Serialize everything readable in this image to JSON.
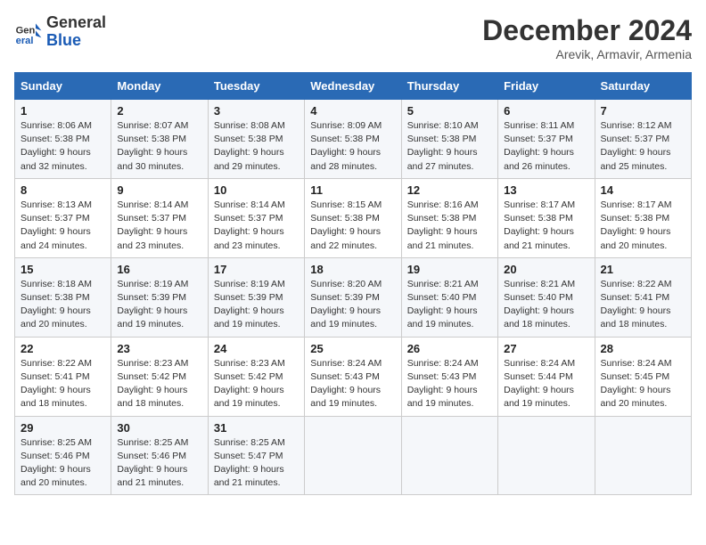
{
  "header": {
    "logo_line1": "General",
    "logo_line2": "Blue",
    "month": "December 2024",
    "location": "Arevik, Armavir, Armenia"
  },
  "days_of_week": [
    "Sunday",
    "Monday",
    "Tuesday",
    "Wednesday",
    "Thursday",
    "Friday",
    "Saturday"
  ],
  "weeks": [
    [
      {
        "day": "1",
        "info": "Sunrise: 8:06 AM\nSunset: 5:38 PM\nDaylight: 9 hours\nand 32 minutes."
      },
      {
        "day": "2",
        "info": "Sunrise: 8:07 AM\nSunset: 5:38 PM\nDaylight: 9 hours\nand 30 minutes."
      },
      {
        "day": "3",
        "info": "Sunrise: 8:08 AM\nSunset: 5:38 PM\nDaylight: 9 hours\nand 29 minutes."
      },
      {
        "day": "4",
        "info": "Sunrise: 8:09 AM\nSunset: 5:38 PM\nDaylight: 9 hours\nand 28 minutes."
      },
      {
        "day": "5",
        "info": "Sunrise: 8:10 AM\nSunset: 5:38 PM\nDaylight: 9 hours\nand 27 minutes."
      },
      {
        "day": "6",
        "info": "Sunrise: 8:11 AM\nSunset: 5:37 PM\nDaylight: 9 hours\nand 26 minutes."
      },
      {
        "day": "7",
        "info": "Sunrise: 8:12 AM\nSunset: 5:37 PM\nDaylight: 9 hours\nand 25 minutes."
      }
    ],
    [
      {
        "day": "8",
        "info": "Sunrise: 8:13 AM\nSunset: 5:37 PM\nDaylight: 9 hours\nand 24 minutes."
      },
      {
        "day": "9",
        "info": "Sunrise: 8:14 AM\nSunset: 5:37 PM\nDaylight: 9 hours\nand 23 minutes."
      },
      {
        "day": "10",
        "info": "Sunrise: 8:14 AM\nSunset: 5:37 PM\nDaylight: 9 hours\nand 23 minutes."
      },
      {
        "day": "11",
        "info": "Sunrise: 8:15 AM\nSunset: 5:38 PM\nDaylight: 9 hours\nand 22 minutes."
      },
      {
        "day": "12",
        "info": "Sunrise: 8:16 AM\nSunset: 5:38 PM\nDaylight: 9 hours\nand 21 minutes."
      },
      {
        "day": "13",
        "info": "Sunrise: 8:17 AM\nSunset: 5:38 PM\nDaylight: 9 hours\nand 21 minutes."
      },
      {
        "day": "14",
        "info": "Sunrise: 8:17 AM\nSunset: 5:38 PM\nDaylight: 9 hours\nand 20 minutes."
      }
    ],
    [
      {
        "day": "15",
        "info": "Sunrise: 8:18 AM\nSunset: 5:38 PM\nDaylight: 9 hours\nand 20 minutes."
      },
      {
        "day": "16",
        "info": "Sunrise: 8:19 AM\nSunset: 5:39 PM\nDaylight: 9 hours\nand 19 minutes."
      },
      {
        "day": "17",
        "info": "Sunrise: 8:19 AM\nSunset: 5:39 PM\nDaylight: 9 hours\nand 19 minutes."
      },
      {
        "day": "18",
        "info": "Sunrise: 8:20 AM\nSunset: 5:39 PM\nDaylight: 9 hours\nand 19 minutes."
      },
      {
        "day": "19",
        "info": "Sunrise: 8:21 AM\nSunset: 5:40 PM\nDaylight: 9 hours\nand 19 minutes."
      },
      {
        "day": "20",
        "info": "Sunrise: 8:21 AM\nSunset: 5:40 PM\nDaylight: 9 hours\nand 18 minutes."
      },
      {
        "day": "21",
        "info": "Sunrise: 8:22 AM\nSunset: 5:41 PM\nDaylight: 9 hours\nand 18 minutes."
      }
    ],
    [
      {
        "day": "22",
        "info": "Sunrise: 8:22 AM\nSunset: 5:41 PM\nDaylight: 9 hours\nand 18 minutes."
      },
      {
        "day": "23",
        "info": "Sunrise: 8:23 AM\nSunset: 5:42 PM\nDaylight: 9 hours\nand 18 minutes."
      },
      {
        "day": "24",
        "info": "Sunrise: 8:23 AM\nSunset: 5:42 PM\nDaylight: 9 hours\nand 19 minutes."
      },
      {
        "day": "25",
        "info": "Sunrise: 8:24 AM\nSunset: 5:43 PM\nDaylight: 9 hours\nand 19 minutes."
      },
      {
        "day": "26",
        "info": "Sunrise: 8:24 AM\nSunset: 5:43 PM\nDaylight: 9 hours\nand 19 minutes."
      },
      {
        "day": "27",
        "info": "Sunrise: 8:24 AM\nSunset: 5:44 PM\nDaylight: 9 hours\nand 19 minutes."
      },
      {
        "day": "28",
        "info": "Sunrise: 8:24 AM\nSunset: 5:45 PM\nDaylight: 9 hours\nand 20 minutes."
      }
    ],
    [
      {
        "day": "29",
        "info": "Sunrise: 8:25 AM\nSunset: 5:46 PM\nDaylight: 9 hours\nand 20 minutes."
      },
      {
        "day": "30",
        "info": "Sunrise: 8:25 AM\nSunset: 5:46 PM\nDaylight: 9 hours\nand 21 minutes."
      },
      {
        "day": "31",
        "info": "Sunrise: 8:25 AM\nSunset: 5:47 PM\nDaylight: 9 hours\nand 21 minutes."
      },
      {
        "day": "",
        "info": ""
      },
      {
        "day": "",
        "info": ""
      },
      {
        "day": "",
        "info": ""
      },
      {
        "day": "",
        "info": ""
      }
    ]
  ]
}
